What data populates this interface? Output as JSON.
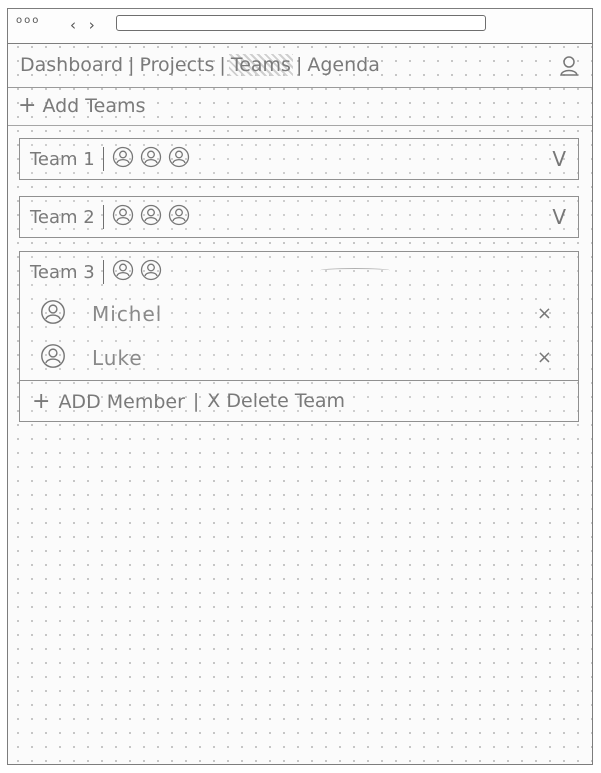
{
  "window": {
    "dots": "ooo",
    "back_arrow": "‹",
    "forward_arrow": "›",
    "url": ""
  },
  "nav": {
    "items": [
      {
        "label": "Dashboard"
      },
      {
        "label": "Projects"
      },
      {
        "label": "Teams",
        "active": true
      },
      {
        "label": "Agenda"
      }
    ],
    "separator": "|",
    "user_icon": "user-icon"
  },
  "add_teams": {
    "plus": "+",
    "label": "Add Teams"
  },
  "teams": [
    {
      "name": "Team 1",
      "avatar_count": 3,
      "expanded": false,
      "chevron": "V"
    },
    {
      "name": "Team 2",
      "avatar_count": 3,
      "expanded": false,
      "chevron": "V"
    },
    {
      "name": "Team 3",
      "avatar_count": 2,
      "expanded": true,
      "members": [
        {
          "name": "Michel",
          "remove": "×"
        },
        {
          "name": "Luke",
          "remove": "×"
        }
      ],
      "actions": {
        "plus": "+",
        "add_member": "ADD Member",
        "separator": "|",
        "delete_prefix": "X",
        "delete_team": "Delete Team"
      }
    }
  ],
  "colors": {
    "stroke": "#7d7d7d",
    "text": "#7a7a7a",
    "grid_dot": "#b9b9b9"
  }
}
